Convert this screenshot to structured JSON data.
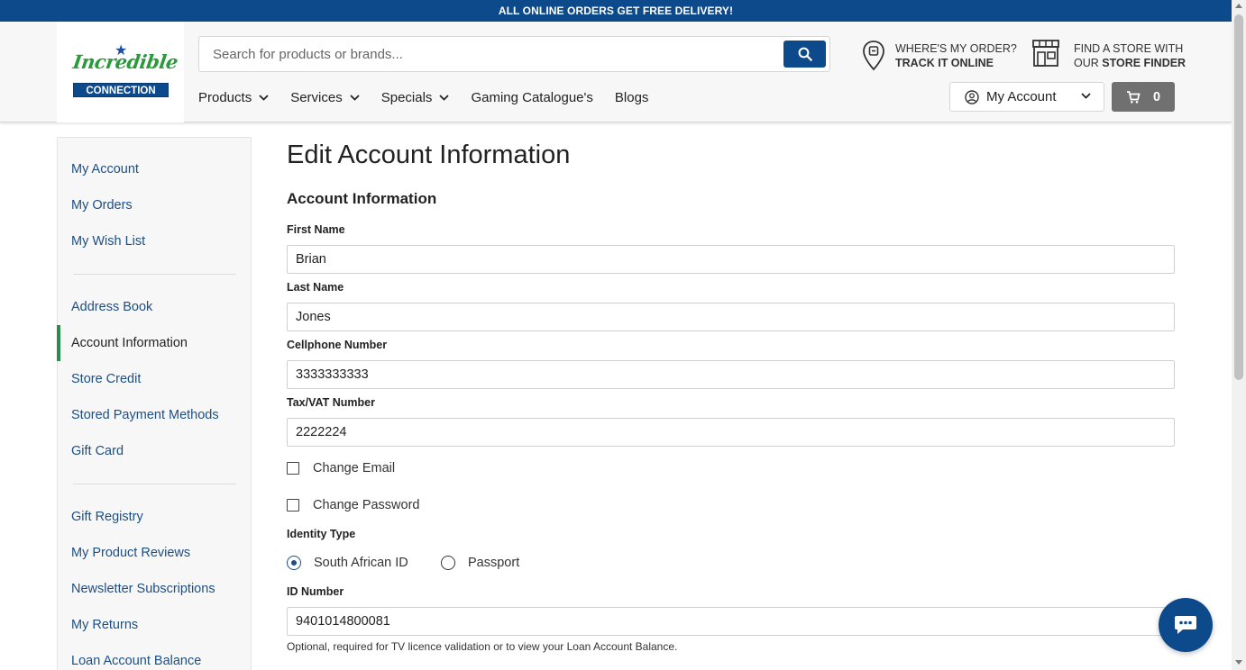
{
  "promo": {
    "text": "ALL ONLINE ORDERS GET FREE DELIVERY!"
  },
  "brand": {
    "script": "Incredible",
    "plate": "CONNECTION",
    "primary_color": "#0d4a8b",
    "green": "#2a9a3c"
  },
  "search": {
    "placeholder": "Search for products or brands...",
    "value": "",
    "button_icon": "search-icon"
  },
  "utility": {
    "track_line1": "WHERE'S MY ORDER?",
    "track_line2": "TRACK IT ONLINE",
    "store_line1": "FIND A STORE WITH",
    "store_line2_prefix": "OUR ",
    "store_line2_bold": "STORE FINDER"
  },
  "nav": {
    "products": "Products",
    "services": "Services",
    "specials": "Specials",
    "gaming": "Gaming Catalogue's",
    "blogs": "Blogs"
  },
  "account_menu": {
    "label": "My Account"
  },
  "cart": {
    "count": "0"
  },
  "sidebar": {
    "items": [
      {
        "label": "My Account"
      },
      {
        "label": "My Orders"
      },
      {
        "label": "My Wish List"
      },
      {
        "label": "Address Book"
      },
      {
        "label": "Account Information",
        "active": true
      },
      {
        "label": "Store Credit"
      },
      {
        "label": "Stored Payment Methods"
      },
      {
        "label": "Gift Card"
      },
      {
        "label": "Gift Registry"
      },
      {
        "label": "My Product Reviews"
      },
      {
        "label": "Newsletter Subscriptions"
      },
      {
        "label": "My Returns"
      },
      {
        "label": "Loan Account Balance"
      }
    ]
  },
  "form": {
    "page_title": "Edit Account Information",
    "section_title": "Account Information",
    "first_name": {
      "label": "First Name",
      "value": "Brian"
    },
    "last_name": {
      "label": "Last Name",
      "value": "Jones"
    },
    "cellphone": {
      "label": "Cellphone Number",
      "value": "3333333333"
    },
    "tax_vat": {
      "label": "Tax/VAT Number",
      "value": "2222224"
    },
    "change_email": {
      "label": "Change Email",
      "checked": false
    },
    "change_password": {
      "label": "Change Password",
      "checked": false
    },
    "identity_type": {
      "label": "Identity Type",
      "options": [
        "South African ID",
        "Passport"
      ],
      "selected": "South African ID"
    },
    "id_number": {
      "label": "ID Number",
      "value": "9401014800081",
      "note": "Optional, required for TV licence validation or to view your Loan Account Balance."
    }
  },
  "chat": {
    "icon": "chat-bubble-icon"
  }
}
